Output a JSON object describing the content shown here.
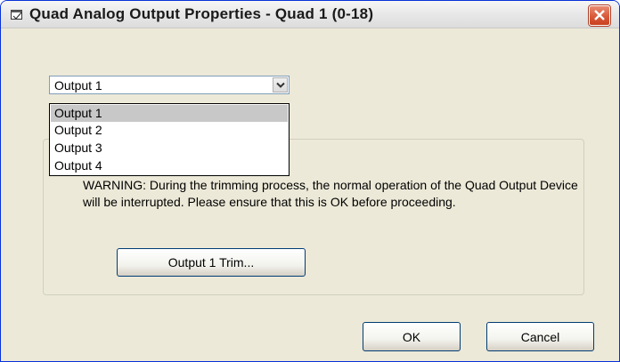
{
  "window": {
    "title": "Quad Analog Output Properties - Quad 1 (0-18)"
  },
  "output_select": {
    "value": "Output 1",
    "options": [
      "Output 1",
      "Output 2",
      "Output 3",
      "Output 4"
    ],
    "highlighted_index": 0
  },
  "trim_group": {
    "warning_text": "WARNING: During the trimming process, the normal operation of the Quad Output Device will be interrupted.  Please ensure that this is OK before proceeding.",
    "trim_button_label": "Output 1 Trim..."
  },
  "footer": {
    "ok_label": "OK",
    "cancel_label": "Cancel"
  },
  "colors": {
    "dialog_bg": "#ece9d8",
    "close_button": "#d9593b",
    "selection_highlight": "#c8c8c8"
  },
  "icons": {
    "title": "window-properties-icon",
    "close": "close-icon",
    "dropdown": "chevron-down-icon"
  }
}
